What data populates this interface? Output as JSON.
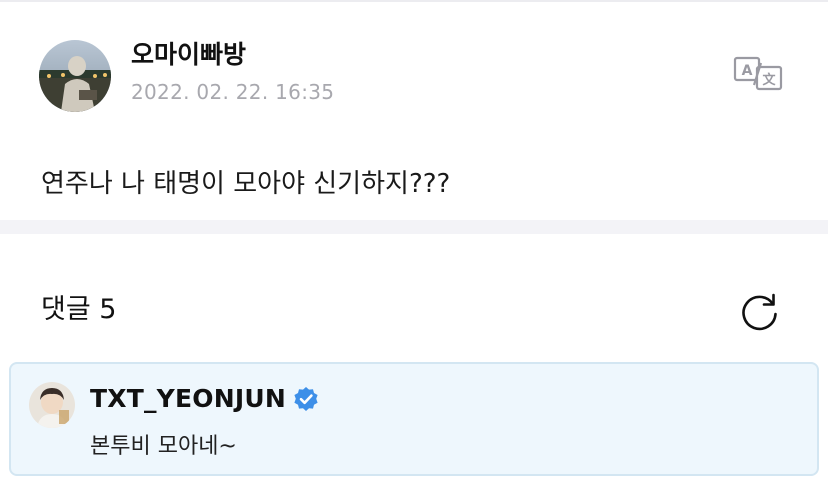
{
  "post": {
    "author_name": "오마이빠방",
    "timestamp": "2022. 02. 22. 16:35",
    "body": "연주나 나 태명이 모아야 신기하지???",
    "translate_icon": "translate-icon"
  },
  "comments": {
    "title": "댓글 5",
    "refresh_icon": "refresh-icon",
    "items": [
      {
        "author": "TXT_YEONJUN",
        "verified": true,
        "text": "본투비 모아네~"
      }
    ]
  },
  "colors": {
    "accent_blue": "#3d8fe8",
    "comment_background": "#eef7fd",
    "timestamp_gray": "#a8a8ae"
  }
}
